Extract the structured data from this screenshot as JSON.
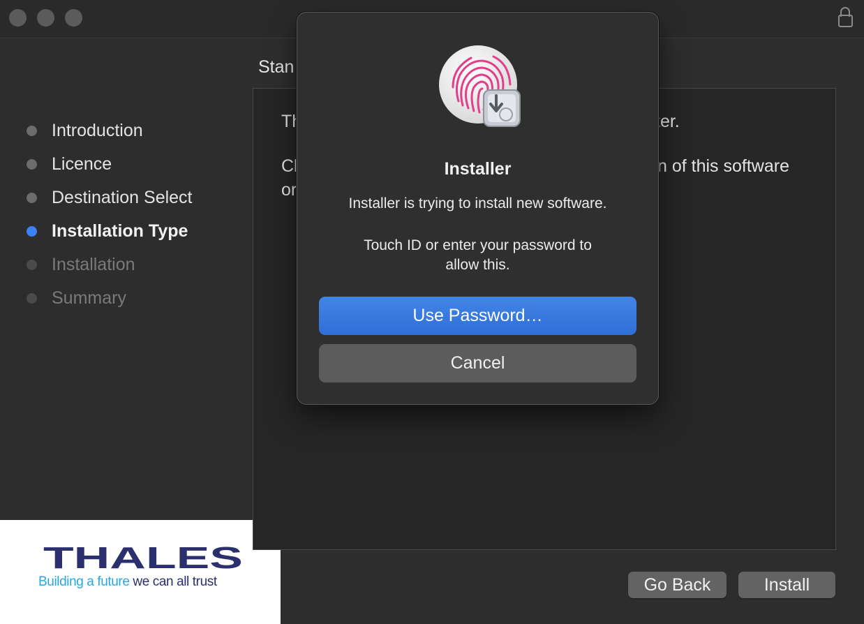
{
  "window": {
    "heading": "Stan",
    "content_lines": [
      "Th",
      "ter.",
      "Cl",
      "n of this software",
      "or"
    ]
  },
  "sidebar": {
    "steps": [
      {
        "label": "Introduction",
        "state": "done"
      },
      {
        "label": "Licence",
        "state": "done"
      },
      {
        "label": "Destination Select",
        "state": "done"
      },
      {
        "label": "Installation Type",
        "state": "active"
      },
      {
        "label": "Installation",
        "state": "future"
      },
      {
        "label": "Summary",
        "state": "future"
      }
    ]
  },
  "logo": {
    "wordmark": "THALES",
    "tagline_part1": "Building a future",
    "tagline_part2": " we can all trust"
  },
  "footer": {
    "go_back_label": "Go Back",
    "install_label": "Install"
  },
  "dialog": {
    "title": "Installer",
    "message": "Installer is trying to install new software.",
    "prompt_line1": "Touch ID or enter your password to",
    "prompt_line2": "allow this.",
    "use_password_label": "Use Password…",
    "cancel_label": "Cancel",
    "icon": "touch-id-fingerprint-icon"
  },
  "colors": {
    "accent": "#3b82f6",
    "brand_navy": "#2b2f6e",
    "brand_cyan": "#2aa6df"
  }
}
